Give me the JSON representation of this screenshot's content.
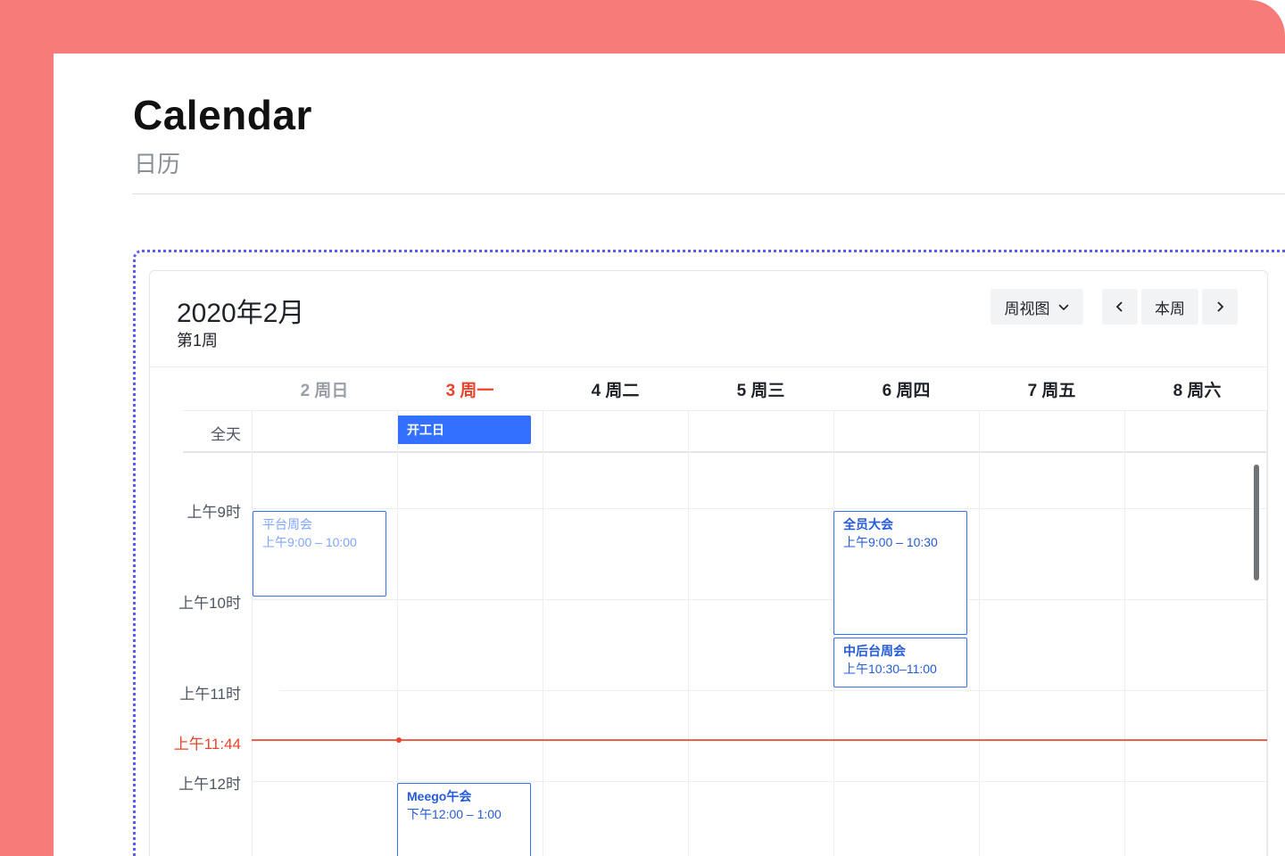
{
  "page": {
    "title": "Calendar",
    "subtitle": "日历"
  },
  "calendar": {
    "month": "2020年2月",
    "week": "第1周",
    "view_button": "周视图",
    "today_button": "本周",
    "days": [
      {
        "label": "2 周日",
        "state": "past"
      },
      {
        "label": "3 周一",
        "state": "today"
      },
      {
        "label": "4 周二",
        "state": "future"
      },
      {
        "label": "5 周三",
        "state": "future"
      },
      {
        "label": "6 周四",
        "state": "future"
      },
      {
        "label": "7 周五",
        "state": "future"
      },
      {
        "label": "8 周六",
        "state": "future"
      }
    ],
    "allday_label": "全天",
    "allday_events": [
      {
        "title": "开工日",
        "day": "3 周一"
      }
    ],
    "time_labels": {
      "h9": "上午9时",
      "h10": "上午10时",
      "h11": "上午11时",
      "h12": "上午12时"
    },
    "now_label": "上午11:44",
    "events": [
      {
        "title": "平台周会",
        "time": "上午9:00 – 10:00",
        "day": "2 周日"
      },
      {
        "title": "全员大会",
        "time": "上午9:00 – 10:30",
        "day": "6 周四"
      },
      {
        "title": "中后台周会",
        "time": "上午10:30–11:00",
        "day": "6 周四"
      },
      {
        "title": "Meego午会",
        "time": "下午12:00 – 1:00",
        "day": "3 周一"
      }
    ]
  },
  "colors": {
    "accent": "#3370ff",
    "today": "#e8452c",
    "frame": "#f77b79",
    "dotted_border": "#5b5ee6"
  },
  "icons": {
    "view_dropdown": "chevron-down-icon",
    "prev": "chevron-left-icon",
    "next": "chevron-right-icon"
  }
}
